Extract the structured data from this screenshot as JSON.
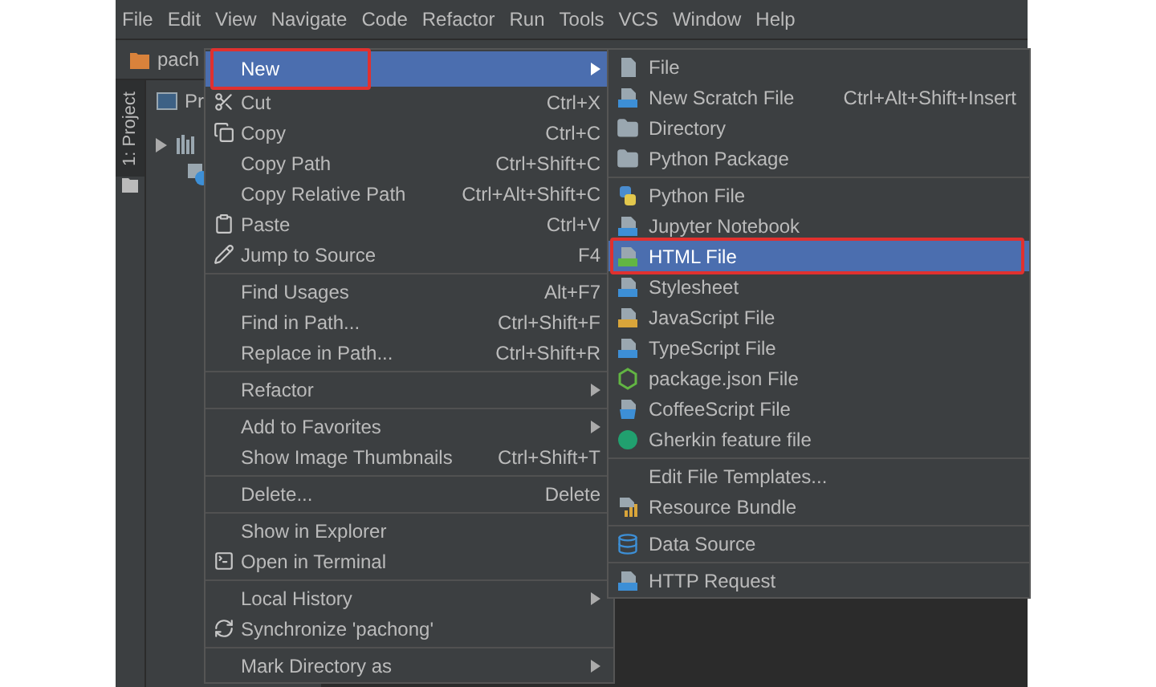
{
  "menu_bar": [
    "File",
    "Edit",
    "View",
    "Navigate",
    "Code",
    "Refactor",
    "Run",
    "Tools",
    "VCS",
    "Window",
    "Help"
  ],
  "breadcrumb": "pach",
  "tool_window_tab": "1: Project",
  "project_panel": {
    "title": "Pr"
  },
  "context_menu": {
    "items": [
      {
        "kind": "item",
        "label": "New",
        "submenu": true,
        "selected": true,
        "annotated": true
      },
      {
        "kind": "item",
        "label": "Cut",
        "shortcut": "Ctrl+X",
        "selected": false
      },
      {
        "kind": "item",
        "label": "Copy",
        "shortcut": "Ctrl+C",
        "selected": false
      },
      {
        "kind": "item",
        "label": "Copy Path",
        "shortcut": "Ctrl+Shift+C",
        "selected": false
      },
      {
        "kind": "item",
        "label": "Copy Relative Path",
        "shortcut": "Ctrl+Alt+Shift+C",
        "selected": false
      },
      {
        "kind": "item",
        "label": "Paste",
        "shortcut": "Ctrl+V",
        "selected": false
      },
      {
        "kind": "item",
        "label": "Jump to Source",
        "shortcut": "F4",
        "selected": false
      },
      {
        "kind": "separator"
      },
      {
        "kind": "item",
        "label": "Find Usages",
        "shortcut": "Alt+F7",
        "selected": false
      },
      {
        "kind": "item",
        "label": "Find in Path...",
        "shortcut": "Ctrl+Shift+F",
        "selected": false
      },
      {
        "kind": "item",
        "label": "Replace in Path...",
        "shortcut": "Ctrl+Shift+R",
        "selected": false
      },
      {
        "kind": "separator"
      },
      {
        "kind": "item",
        "label": "Refactor",
        "submenu": true,
        "selected": false
      },
      {
        "kind": "separator"
      },
      {
        "kind": "item",
        "label": "Add to Favorites",
        "submenu": true,
        "selected": false
      },
      {
        "kind": "item",
        "label": "Show Image Thumbnails",
        "shortcut": "Ctrl+Shift+T",
        "selected": false
      },
      {
        "kind": "separator"
      },
      {
        "kind": "item",
        "label": "Delete...",
        "shortcut": "Delete",
        "selected": false
      },
      {
        "kind": "separator"
      },
      {
        "kind": "item",
        "label": "Show in Explorer",
        "selected": false
      },
      {
        "kind": "item",
        "label": "Open in Terminal",
        "selected": false
      },
      {
        "kind": "separator"
      },
      {
        "kind": "item",
        "label": "Local History",
        "submenu": true,
        "selected": false
      },
      {
        "kind": "item",
        "label": "Synchronize 'pachong'",
        "selected": false
      },
      {
        "kind": "separator"
      },
      {
        "kind": "item",
        "label": "Mark Directory as",
        "submenu": true,
        "selected": false
      }
    ]
  },
  "new_submenu": {
    "items": [
      {
        "kind": "item",
        "label": "File",
        "selected": false
      },
      {
        "kind": "item",
        "label": "New Scratch File",
        "shortcut": "Ctrl+Alt+Shift+Insert",
        "selected": false
      },
      {
        "kind": "item",
        "label": "Directory",
        "selected": false
      },
      {
        "kind": "item",
        "label": "Python Package",
        "selected": false
      },
      {
        "kind": "separator"
      },
      {
        "kind": "item",
        "label": "Python File",
        "selected": false
      },
      {
        "kind": "item",
        "label": "Jupyter Notebook",
        "selected": false
      },
      {
        "kind": "item",
        "label": "HTML File",
        "selected": true,
        "annotated": true
      },
      {
        "kind": "item",
        "label": "Stylesheet",
        "selected": false
      },
      {
        "kind": "item",
        "label": "JavaScript File",
        "selected": false
      },
      {
        "kind": "item",
        "label": "TypeScript File",
        "selected": false
      },
      {
        "kind": "item",
        "label": "package.json File",
        "selected": false
      },
      {
        "kind": "item",
        "label": "CoffeeScript File",
        "selected": false
      },
      {
        "kind": "item",
        "label": "Gherkin feature file",
        "selected": false
      },
      {
        "kind": "separator"
      },
      {
        "kind": "item",
        "label": "Edit File Templates...",
        "selected": false
      },
      {
        "kind": "item",
        "label": "Resource Bundle",
        "selected": false
      },
      {
        "kind": "separator"
      },
      {
        "kind": "item",
        "label": "Data Source",
        "selected": false
      },
      {
        "kind": "separator"
      },
      {
        "kind": "item",
        "label": "HTTP Request",
        "selected": false
      }
    ]
  }
}
